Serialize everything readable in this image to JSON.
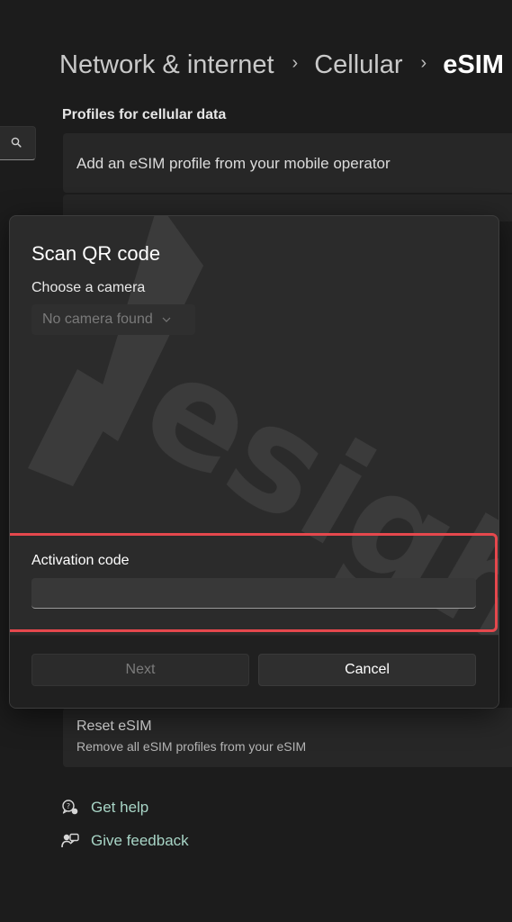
{
  "header": {
    "breadcrumb": [
      "Network & internet",
      "Cellular",
      "eSIM"
    ],
    "separator": "›"
  },
  "profiles": {
    "section_label": "Profiles for cellular data",
    "add_profile_text": "Add an eSIM profile from your mobile operator"
  },
  "reset": {
    "title": "Reset eSIM",
    "subtitle": "Remove all eSIM profiles from your eSIM"
  },
  "help": {
    "get_help": "Get help",
    "give_feedback": "Give feedback"
  },
  "dialog": {
    "title": "Scan QR code",
    "camera_label": "Choose a camera",
    "camera_value": "No camera found",
    "activation_label": "Activation code",
    "activation_value": "",
    "next_label": "Next",
    "cancel_label": "Cancel"
  },
  "colors": {
    "accent_link": "#a8d5c6",
    "highlight": "#e5484d"
  },
  "icons": {
    "search": "search-icon",
    "chevron": "chevron-down-icon",
    "get_help": "help-chat-icon",
    "feedback": "feedback-icon"
  }
}
